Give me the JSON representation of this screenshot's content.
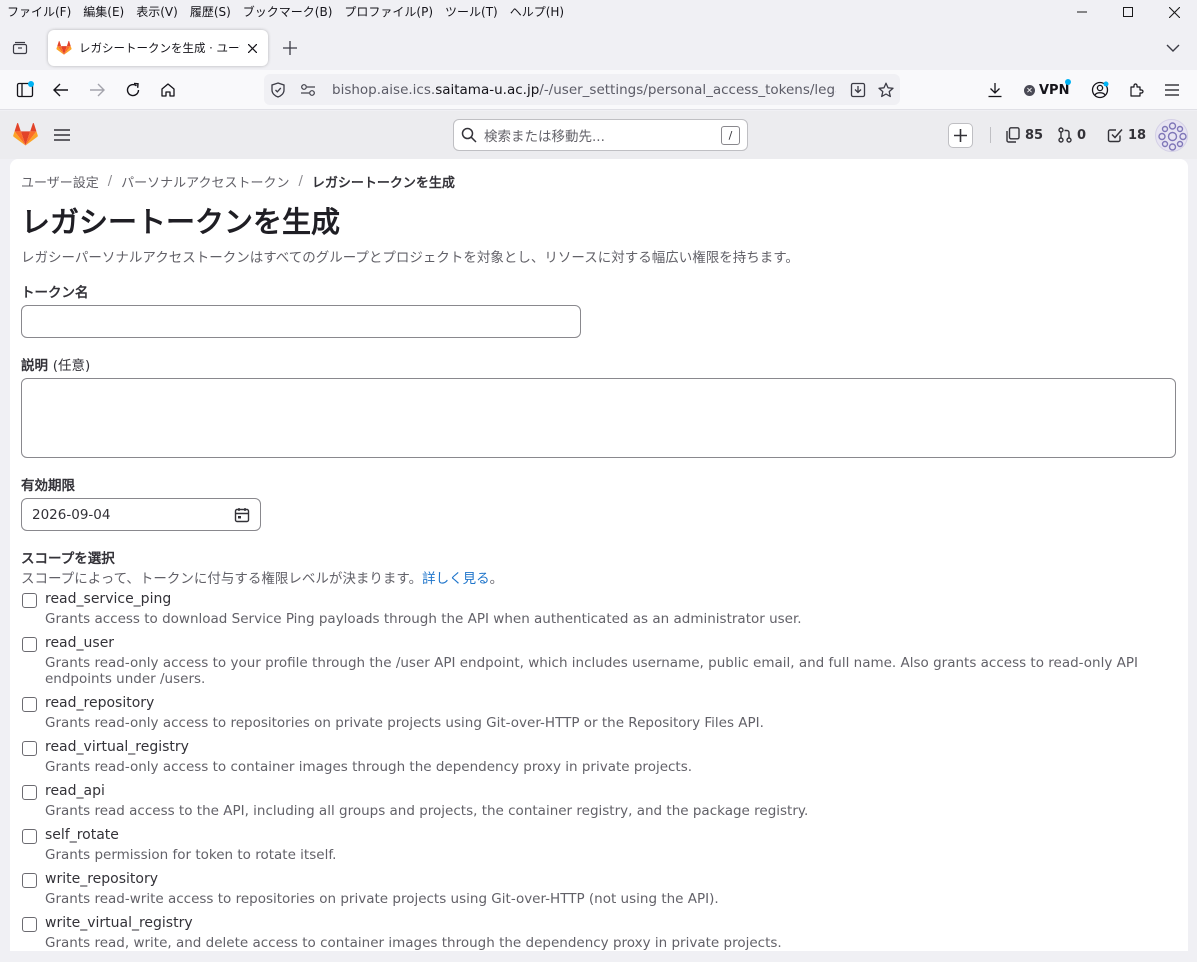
{
  "menubar": {
    "items": [
      "ファイル(F)",
      "編集(E)",
      "表示(V)",
      "履歴(S)",
      "ブックマーク(B)",
      "プロファイル(P)",
      "ツール(T)",
      "ヘルプ(H)"
    ]
  },
  "tab": {
    "title": "レガシートークンを生成 · ユーザー設定"
  },
  "urlbar": {
    "prefix": "bishop.aise.ics.",
    "host": "saitama-u.ac.jp",
    "path": "/-/user_settings/personal_access_tokens/legacy/new"
  },
  "vpn": {
    "label": "VPN"
  },
  "gitlab": {
    "search_placeholder": "検索または移動先...",
    "search_shortcut": "/",
    "merge_requests_count": "85",
    "code_review_count": "0",
    "todos_count": "18"
  },
  "breadcrumb": {
    "items": [
      "ユーザー設定",
      "パーソナルアクセストークン"
    ],
    "current": "レガシートークンを生成"
  },
  "page": {
    "title": "レガシートークンを生成",
    "description": "レガシーパーソナルアクセストークンはすべてのグループとプロジェクトを対象とし、リソースに対する幅広い権限を持ちます。"
  },
  "form": {
    "token_name_label": "トークン名",
    "token_name_value": "",
    "description_label": "説明",
    "description_optional": "(任意)",
    "description_value": "",
    "expiry_label": "有効期限",
    "expiry_value": "2026-09-04"
  },
  "scopes": {
    "title": "スコープを選択",
    "description": "スコープによって、トークンに付与する権限レベルが決まります。",
    "learn_more": "詳しく見る",
    "learn_more_suffix": "。",
    "items": [
      {
        "name": "read_service_ping",
        "desc": "Grants access to download Service Ping payloads through the API when authenticated as an administrator user.",
        "checked": false
      },
      {
        "name": "read_user",
        "desc": "Grants read-only access to your profile through the /user API endpoint, which includes username, public email, and full name. Also grants access to read-only API endpoints under /users.",
        "checked": false
      },
      {
        "name": "read_repository",
        "desc": "Grants read-only access to repositories on private projects using Git-over-HTTP or the Repository Files API.",
        "checked": false
      },
      {
        "name": "read_virtual_registry",
        "desc": "Grants read-only access to container images through the dependency proxy in private projects.",
        "checked": false
      },
      {
        "name": "read_api",
        "desc": "Grants read access to the API, including all groups and projects, the container registry, and the package registry.",
        "checked": false
      },
      {
        "name": "self_rotate",
        "desc": "Grants permission for token to rotate itself.",
        "checked": false
      },
      {
        "name": "write_repository",
        "desc": "Grants read-write access to repositories on private projects using Git-over-HTTP (not using the API).",
        "checked": false
      },
      {
        "name": "write_virtual_registry",
        "desc": "Grants read, write, and delete access to container images through the dependency proxy in private projects.",
        "checked": false
      }
    ]
  },
  "colors": {
    "gitlab_orange": "#fc6d26",
    "link": "#1f75cb",
    "header_bg": "#ececef"
  }
}
